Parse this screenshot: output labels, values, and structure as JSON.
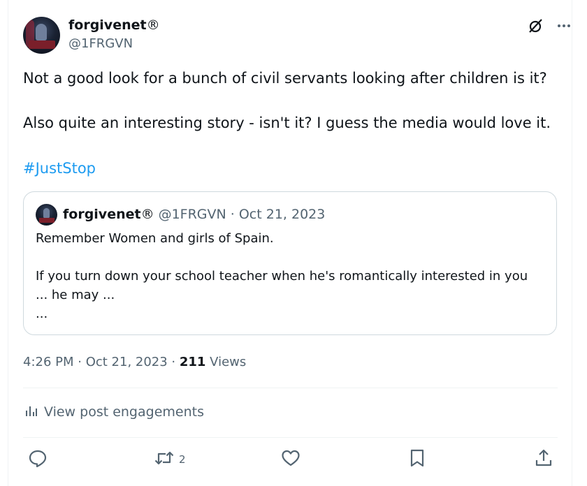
{
  "author": {
    "name": "forgivenet",
    "badge": "®",
    "handle": "@1FRGVN"
  },
  "header_icons": [
    "grok-icon",
    "more-icon"
  ],
  "post": {
    "line1": "Not a good look for a bunch of civil servants looking after children is it?",
    "line2": "Also quite an interesting story - isn't it? I guess the media would love it.",
    "hashtag": "#JustStop"
  },
  "quoted_post": {
    "name": "forgivenet",
    "badge": "®",
    "meta": "@1FRGVN · Oct 21, 2023",
    "line1": "Remember Women and girls of Spain.",
    "line2": "If you turn down your school teacher when he's romantically interested in you",
    "line3": "... he may ...",
    "line4": "..."
  },
  "timestamp": {
    "time_date": "4:26 PM · Oct 21, 2023 · ",
    "views_count": "211",
    "views_label": " Views"
  },
  "engagements_label": "View post engagements",
  "actions": {
    "reply_count": "",
    "repost_count": "2",
    "like_count": "",
    "bookmark_count": ""
  },
  "colors": {
    "text": "#0f1419",
    "secondary": "#536471",
    "link": "#1d9bf0",
    "border": "#cfd9de"
  }
}
